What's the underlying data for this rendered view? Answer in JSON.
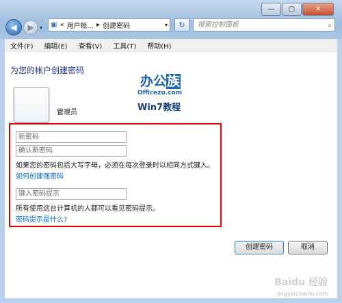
{
  "window": {
    "buttons": {
      "minimize": "—",
      "maximize": "▢",
      "close": "✕"
    }
  },
  "address_bar": {
    "prefix": "«",
    "crumb1": "用户帐...",
    "sep": "▸",
    "crumb2": "创建密码",
    "dropdown": "▾"
  },
  "search": {
    "placeholder": "搜索控制面板"
  },
  "menu": [
    "文件(F)",
    "编辑(E)",
    "查看(V)",
    "工具(T)",
    "帮助(H)"
  ],
  "page": {
    "title": "为您的帐户创建密码",
    "username": "管理员"
  },
  "watermark": {
    "line1a": "办公",
    "line1b": "族",
    "line2": "Officezu.com",
    "line3": "Win7教程"
  },
  "form": {
    "new_password_placeholder": "新密码",
    "confirm_password_placeholder": "确认新密码",
    "caps_note": "如果您的密码包括大写字母，必须在每次登录时以相同方式键入。",
    "strong_link": "如何创建强密码",
    "hint_placeholder": "键入密码提示",
    "hint_note": "所有使用这台计算机的人都可以看见密码提示。",
    "hint_link": "密码提示是什么?"
  },
  "actions": {
    "create": "创建密码",
    "cancel": "取消"
  },
  "credit": {
    "logo": "Baidu 经验",
    "url": "jingyan.baidu.com"
  },
  "colors": {
    "highlight_box": "#e00000",
    "link": "#0066cc",
    "title": "#1e3287"
  }
}
